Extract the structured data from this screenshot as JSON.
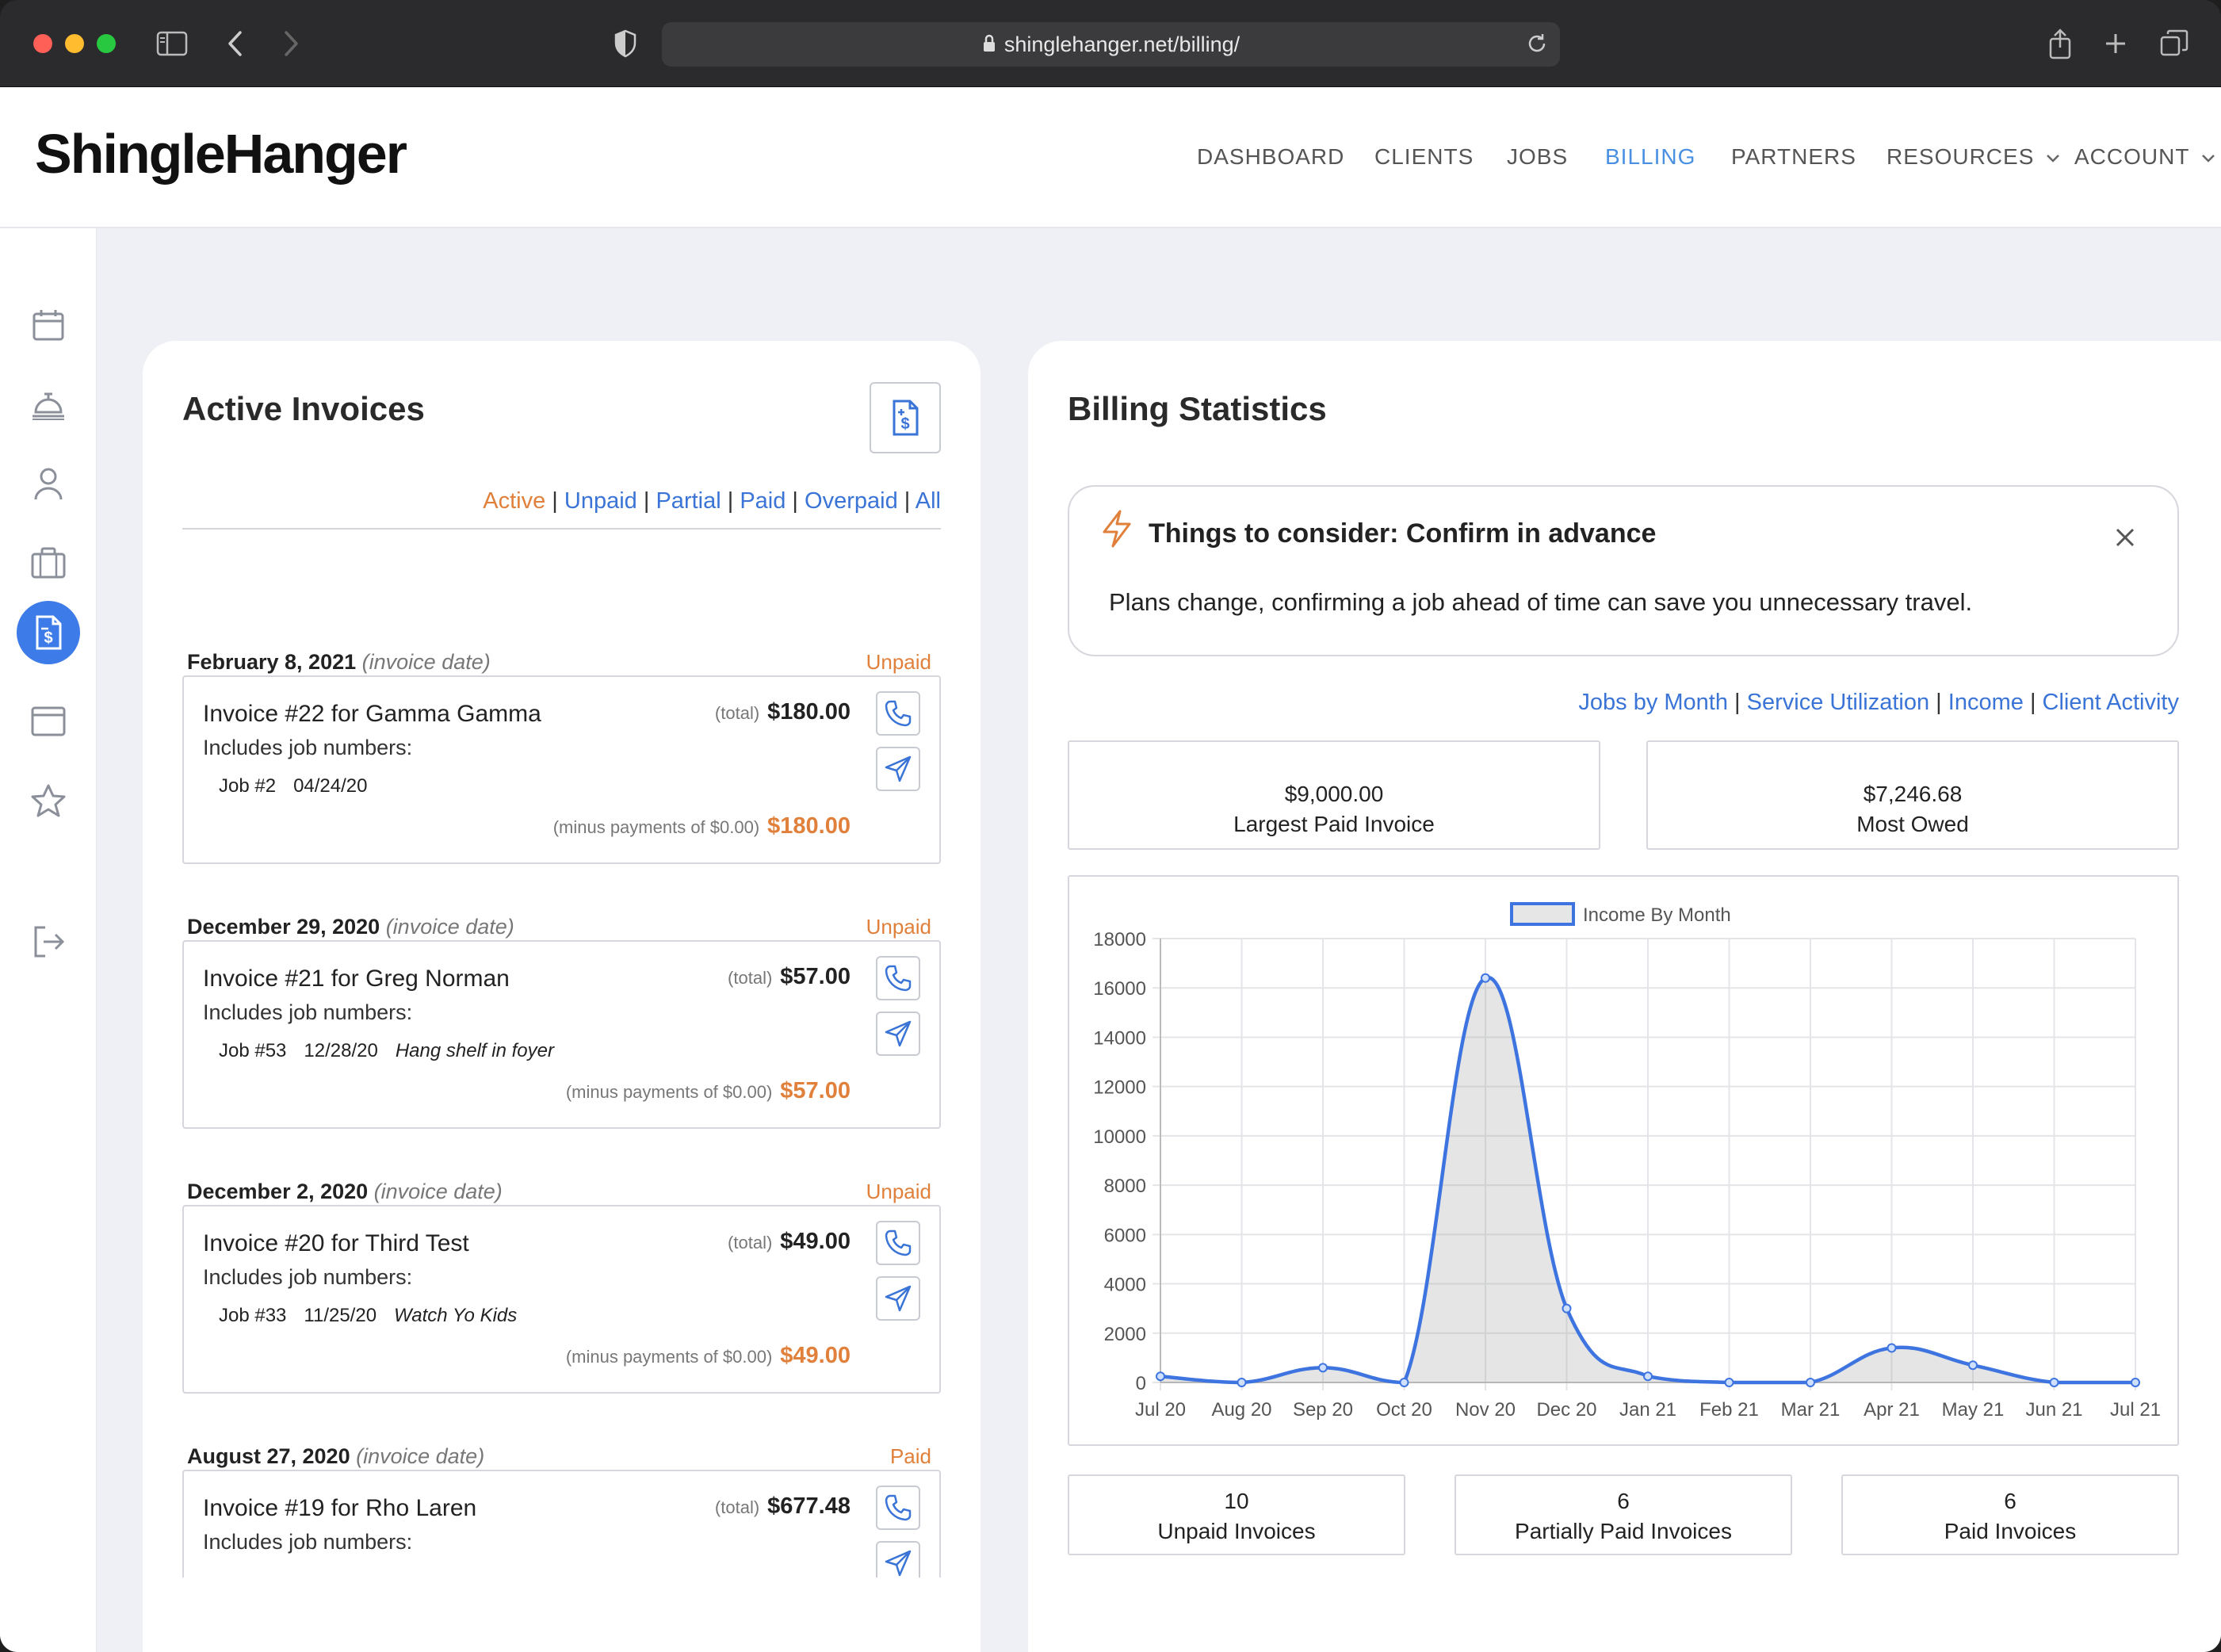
{
  "browser": {
    "url": "shinglehanger.net/billing/"
  },
  "app": {
    "logo": "ShingleHanger"
  },
  "nav": {
    "items": [
      "DASHBOARD",
      "CLIENTS",
      "JOBS",
      "BILLING",
      "PARTNERS",
      "RESOURCES",
      "ACCOUNT"
    ],
    "active": "BILLING"
  },
  "sidebar": {
    "icons": [
      "calendar-icon",
      "service-bell-icon",
      "user-icon",
      "briefcase-icon",
      "invoice-icon",
      "browser-window-icon",
      "star-icon",
      "logout-icon"
    ],
    "active": "invoice-icon"
  },
  "invoices": {
    "title": "Active Invoices",
    "filters": [
      "Active",
      "Unpaid",
      "Partial",
      "Paid",
      "Overpaid",
      "All"
    ],
    "active_filter": "Active",
    "total_label": "(total)",
    "includes_label": "Includes job numbers:",
    "invoice_date_label": "(invoice date)",
    "minus_prefix": "(minus payments of ",
    "minus_suffix": ")",
    "items": [
      {
        "date": "February 8, 2021",
        "status": "Unpaid",
        "title": "Invoice #22 for Gamma Gamma",
        "total": "$180.00",
        "job": "Job #2",
        "job_date": "04/24/20",
        "job_desc": "",
        "payments": "$0.00",
        "balance": "$180.00"
      },
      {
        "date": "December 29, 2020",
        "status": "Unpaid",
        "title": "Invoice #21 for Greg Norman",
        "total": "$57.00",
        "job": "Job #53",
        "job_date": "12/28/20",
        "job_desc": "Hang shelf in foyer",
        "payments": "$0.00",
        "balance": "$57.00"
      },
      {
        "date": "December 2, 2020",
        "status": "Unpaid",
        "title": "Invoice #20 for Third Test",
        "total": "$49.00",
        "job": "Job #33",
        "job_date": "11/25/20",
        "job_desc": "Watch Yo Kids",
        "payments": "$0.00",
        "balance": "$49.00"
      },
      {
        "date": "August 27, 2020",
        "status": "Paid",
        "title": "Invoice #19 for Rho Laren",
        "total": "$677.48",
        "job": "",
        "job_date": "",
        "job_desc": "",
        "payments": "",
        "balance": ""
      }
    ]
  },
  "stats": {
    "title": "Billing Statistics",
    "tip_title": "Things to consider: Confirm in advance",
    "tip_body": "Plans change, confirming a job ahead of time can save you unnecessary travel.",
    "tabs": [
      "Jobs by Month",
      "Service Utilization",
      "Income",
      "Client Activity"
    ],
    "largest_paid_value": "$9,000.00",
    "largest_paid_label": "Largest Paid Invoice",
    "most_owed_value": "$7,246.68",
    "most_owed_label": "Most Owed",
    "unpaid_count": "10",
    "unpaid_label": "Unpaid Invoices",
    "partial_count": "6",
    "partial_label": "Partially Paid Invoices",
    "paid_count": "6",
    "paid_label": "Paid Invoices"
  },
  "colors": {
    "accent": "#3d7be8",
    "link": "#3a74d6",
    "warning": "#e0803a"
  },
  "chart_data": {
    "type": "area",
    "legend": "Income By Month",
    "legend_position": "top",
    "categories": [
      "Jul 20",
      "Aug 20",
      "Sep 20",
      "Oct 20",
      "Nov 20",
      "Dec 20",
      "Jan 21",
      "Feb 21",
      "Mar 21",
      "Apr 21",
      "May 21",
      "Jun 21",
      "Jul 21"
    ],
    "series": [
      {
        "name": "Income By Month",
        "values": [
          250,
          0,
          600,
          0,
          16400,
          3000,
          250,
          0,
          0,
          1400,
          700,
          0,
          0
        ]
      }
    ],
    "ylim": [
      0,
      18000
    ],
    "yticks": [
      0,
      2000,
      4000,
      6000,
      8000,
      10000,
      12000,
      14000,
      16000,
      18000
    ],
    "grid": true
  }
}
